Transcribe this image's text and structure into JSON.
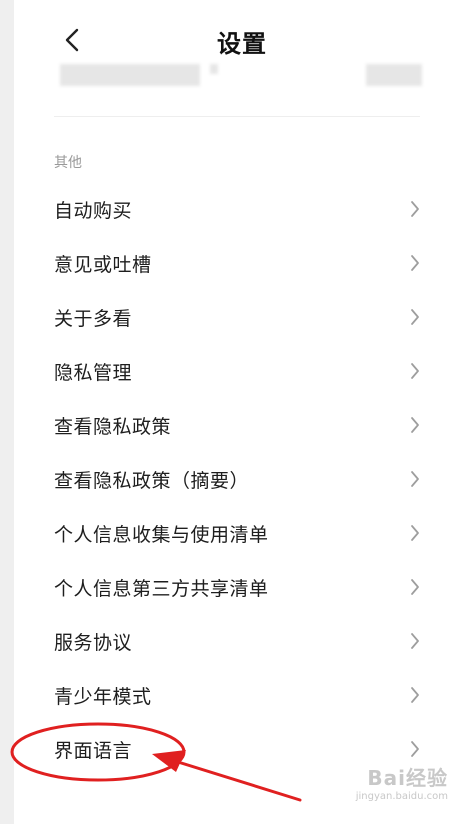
{
  "header": {
    "title": "设置",
    "back_icon": "chevron-left-icon"
  },
  "section": {
    "label": "其他"
  },
  "menu": {
    "items": [
      {
        "label": "自动购买"
      },
      {
        "label": "意见或吐槽"
      },
      {
        "label": "关于多看"
      },
      {
        "label": "隐私管理"
      },
      {
        "label": "查看隐私政策"
      },
      {
        "label": "查看隐私政策（摘要）"
      },
      {
        "label": "个人信息收集与使用清单"
      },
      {
        "label": "个人信息第三方共享清单"
      },
      {
        "label": "服务协议"
      },
      {
        "label": "青少年模式"
      },
      {
        "label": "界面语言"
      }
    ],
    "chevron_icon": "chevron-right-icon"
  },
  "annotation": {
    "highlighted_item": "界面语言",
    "color": "#e02020"
  },
  "watermark": {
    "main": "Bai经验",
    "sub": "jingyan.baidu.com"
  },
  "colors": {
    "background": "#ffffff",
    "text": "#1e1e1e",
    "section_label": "#9a9a9a",
    "chevron": "#9e9e9e",
    "annotation": "#e02020"
  }
}
